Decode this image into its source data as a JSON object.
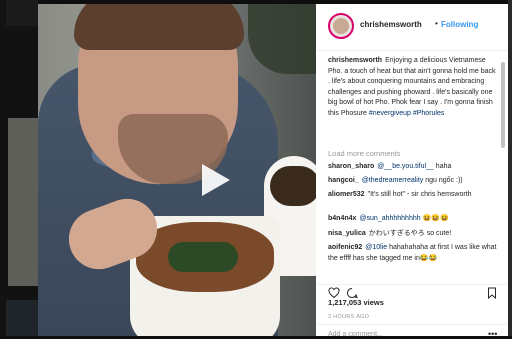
{
  "post": {
    "username": "chrishemsworth",
    "follow_label": "Following",
    "dot": "•"
  },
  "caption": {
    "username": "chrishemsworth",
    "text": "Enjoying a delicious Vietnamese Pho. a touch of heat but that ain't gonna hold me back . life's about conquering mountains and embracing challenges and pushing phoward . life's basically one big bowl of hot Pho. Phok fear I say . I'm gonna finish this Phosure",
    "hashtags": "#nevergiveup #Phorules"
  },
  "load_more": "Load more comments",
  "comments": [
    {
      "user": "sharon_sharo",
      "mention": "@__be.you.tiful__",
      "text": "haha"
    },
    {
      "user": "hangcoi_",
      "mention": "@thedreamerreality",
      "text": "ngu ngốc :))"
    },
    {
      "user": "aliomer532",
      "mention": "",
      "text": "\"It's still hot\" - sir chris hemsworth"
    },
    {
      "user": "b4n4n4x",
      "mention": "@sun_ahhhhhhhhh",
      "text": "😆😆😆"
    },
    {
      "user": "nisa_yulica",
      "mention": "",
      "text": "かわいすぎるやろ so cute!"
    },
    {
      "user": "aoifenic92",
      "mention": "@10lie",
      "text": "hahahahaha at first I was like what the effff has she tagged me in😂😂"
    }
  ],
  "stats": {
    "views": "1,217,053 views",
    "time_ago": "3 HOURS AGO"
  },
  "add_comment_placeholder": "Add a comment...",
  "more_options": "•••",
  "icons": {
    "like": "heart-icon",
    "comment": "comment-icon",
    "save": "bookmark-icon",
    "play": "play-icon"
  },
  "colors": {
    "link": "#3897f0",
    "mention": "#003569",
    "story_ring": "#d9006c"
  }
}
